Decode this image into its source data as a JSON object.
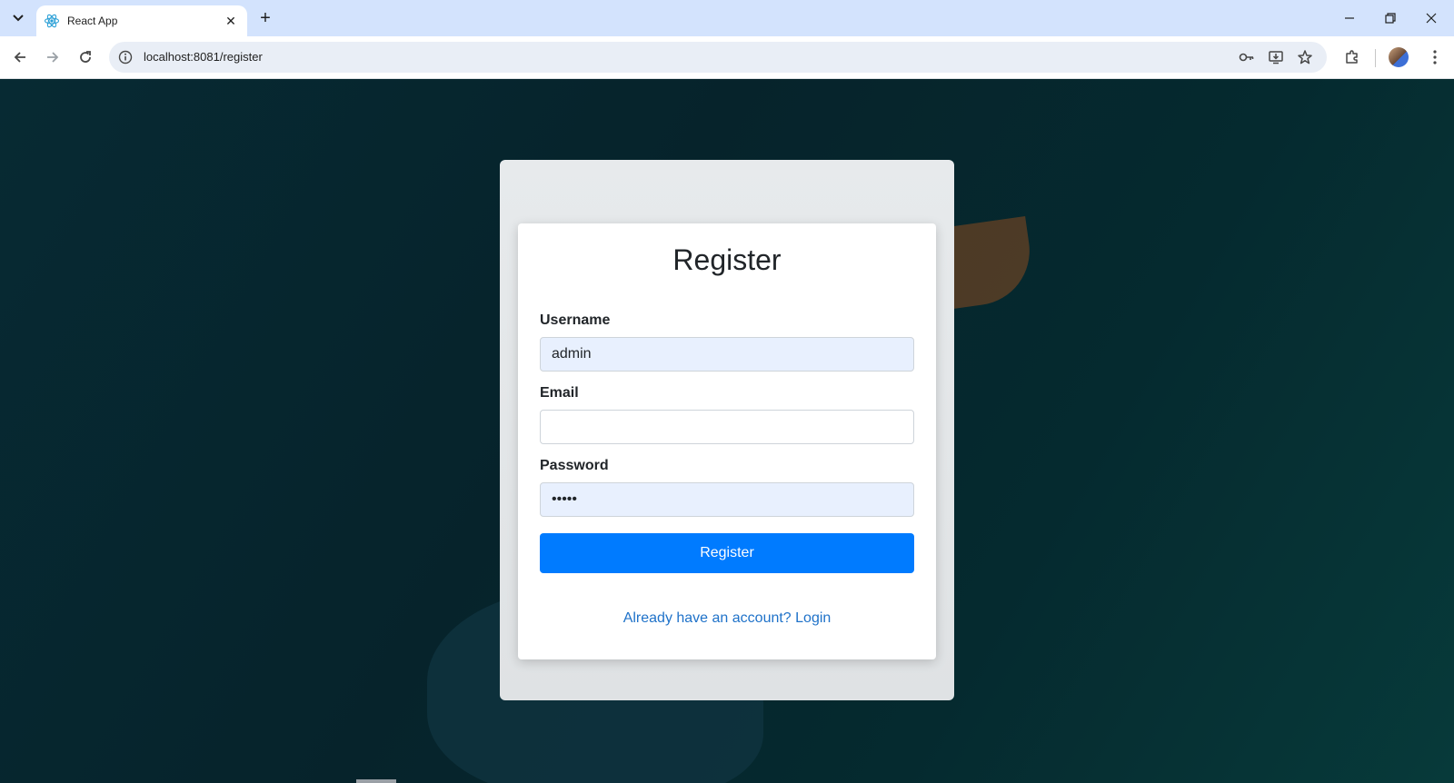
{
  "browser": {
    "tab": {
      "title": "React App",
      "favicon": "react-logo-icon"
    },
    "address": "localhost:8081/register",
    "icons": [
      "tab-list-icon",
      "close-icon",
      "plus-icon",
      "minimize-icon",
      "restore-icon",
      "close-window-icon",
      "back-icon",
      "forward-icon",
      "reload-icon",
      "info-icon",
      "password-key-icon",
      "install-app-icon",
      "star-icon",
      "extensions-icon",
      "menu-icon"
    ]
  },
  "form": {
    "title": "Register",
    "username": {
      "label": "Username",
      "value": "admin"
    },
    "email": {
      "label": "Email",
      "value": ""
    },
    "password": {
      "label": "Password",
      "value": "•••••"
    },
    "submit_label": "Register",
    "login_link": "Already have an account? Login"
  },
  "colors": {
    "primary": "#007bff",
    "link": "#1f72c9",
    "autofill": "#e8f0fe",
    "tabbar": "#d3e3fd"
  }
}
